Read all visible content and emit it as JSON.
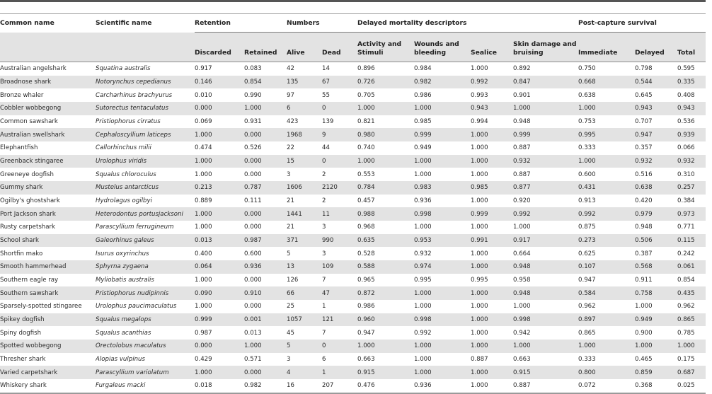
{
  "table": {
    "group_headers": {
      "common_name": "Common name",
      "scientific_name": "Scientific name",
      "retention": "Retention",
      "numbers": "Numbers",
      "delayed_mortality": "Delayed mortality descriptors",
      "post_capture": "Post-capture survival"
    },
    "sub_headers": {
      "discarded": "Discarded",
      "retained": "Retained",
      "alive": "Alive",
      "dead": "Dead",
      "activity": "Activity and Stimuli",
      "wounds": "Wounds and bleeding",
      "sealice": "Sealice",
      "skin": "Skin damage and bruising",
      "immediate": "Immediate",
      "delayed": "Delayed",
      "total": "Total"
    },
    "rows": [
      [
        "Australian angelshark",
        "Squatina australis",
        "0.917",
        "0.083",
        "42",
        "14",
        "0.896",
        "0.984",
        "1.000",
        "0.892",
        "0.750",
        "0.798",
        "0.595"
      ],
      [
        "Broadnose shark",
        "Notorynchus cepedianus",
        "0.146",
        "0.854",
        "135",
        "67",
        "0.726",
        "0.982",
        "0.992",
        "0.847",
        "0.668",
        "0.544",
        "0.335"
      ],
      [
        "Bronze whaler",
        "Carcharhinus brachyurus",
        "0.010",
        "0.990",
        "97",
        "55",
        "0.705",
        "0.986",
        "0.993",
        "0.901",
        "0.638",
        "0.645",
        "0.408"
      ],
      [
        "Cobbler wobbegong",
        "Sutorectus tentaculatus",
        "0.000",
        "1.000",
        "6",
        "0",
        "1.000",
        "1.000",
        "0.943",
        "1.000",
        "1.000",
        "0.943",
        "0.943"
      ],
      [
        "Common sawshark",
        "Pristiophorus cirratus",
        "0.069",
        "0.931",
        "423",
        "139",
        "0.821",
        "0.985",
        "0.994",
        "0.948",
        "0.753",
        "0.707",
        "0.536"
      ],
      [
        "Australian swellshark",
        "Cephaloscyllium laticeps",
        "1.000",
        "0.000",
        "1968",
        "9",
        "0.980",
        "0.999",
        "1.000",
        "0.999",
        "0.995",
        "0.947",
        "0.939"
      ],
      [
        "Elephantfish",
        "Callorhinchus milii",
        "0.474",
        "0.526",
        "22",
        "44",
        "0.740",
        "0.949",
        "1.000",
        "0.887",
        "0.333",
        "0.357",
        "0.066"
      ],
      [
        "Greenback stingaree",
        "Urolophus viridis",
        "1.000",
        "0.000",
        "15",
        "0",
        "1.000",
        "1.000",
        "1.000",
        "0.932",
        "1.000",
        "0.932",
        "0.932"
      ],
      [
        "Greeneye dogfish",
        "Squalus chloroculus",
        "1.000",
        "0.000",
        "3",
        "2",
        "0.553",
        "1.000",
        "1.000",
        "0.887",
        "0.600",
        "0.516",
        "0.310"
      ],
      [
        "Gummy shark",
        "Mustelus antarcticus",
        "0.213",
        "0.787",
        "1606",
        "2120",
        "0.784",
        "0.983",
        "0.985",
        "0.877",
        "0.431",
        "0.638",
        "0.257"
      ],
      [
        "Ogilby's ghostshark",
        "Hydrolagus ogilbyi",
        "0.889",
        "0.111",
        "21",
        "2",
        "0.457",
        "0.936",
        "1.000",
        "0.920",
        "0.913",
        "0.420",
        "0.384"
      ],
      [
        "Port Jackson shark",
        "Heterodontus portusjacksoni",
        "1.000",
        "0.000",
        "1441",
        "11",
        "0.988",
        "0.998",
        "0.999",
        "0.992",
        "0.992",
        "0.979",
        "0.973"
      ],
      [
        "Rusty carpetshark",
        "Parascyllium ferrugineum",
        "1.000",
        "0.000",
        "21",
        "3",
        "0.968",
        "1.000",
        "1.000",
        "1.000",
        "0.875",
        "0.948",
        "0.771"
      ],
      [
        "School shark",
        "Galeorhinus galeus",
        "0.013",
        "0.987",
        "371",
        "990",
        "0.635",
        "0.953",
        "0.991",
        "0.917",
        "0.273",
        "0.506",
        "0.115"
      ],
      [
        "Shortfin mako",
        "Isurus oxyrinchus",
        "0.400",
        "0.600",
        "5",
        "3",
        "0.528",
        "0.932",
        "1.000",
        "0.664",
        "0.625",
        "0.387",
        "0.242"
      ],
      [
        "Smooth hammerhead",
        "Sphyrna zygaena",
        "0.064",
        "0.936",
        "13",
        "109",
        "0.588",
        "0.974",
        "1.000",
        "0.948",
        "0.107",
        "0.568",
        "0.061"
      ],
      [
        "Southern eagle ray",
        "Myliobatis australis",
        "1.000",
        "0.000",
        "126",
        "7",
        "0.965",
        "0.995",
        "0.995",
        "0.958",
        "0.947",
        "0.911",
        "0.854"
      ],
      [
        "Southern sawshark",
        "Pristiophorus nudipinnis",
        "0.090",
        "0.910",
        "66",
        "47",
        "0.872",
        "1.000",
        "1.000",
        "0.948",
        "0.584",
        "0.758",
        "0.435"
      ],
      [
        "Sparsely-spotted stingaree",
        "Urolophus paucimaculatus",
        "1.000",
        "0.000",
        "25",
        "1",
        "0.986",
        "1.000",
        "1.000",
        "1.000",
        "0.962",
        "1.000",
        "0.962"
      ],
      [
        "Spikey dogfish",
        "Squalus megalops",
        "0.999",
        "0.001",
        "1057",
        "121",
        "0.960",
        "0.998",
        "1.000",
        "0.998",
        "0.897",
        "0.949",
        "0.865"
      ],
      [
        "Spiny dogfish",
        "Squalus acanthias",
        "0.987",
        "0.013",
        "45",
        "7",
        "0.947",
        "0.992",
        "1.000",
        "0.942",
        "0.865",
        "0.900",
        "0.785"
      ],
      [
        "Spotted wobbegong",
        "Orectolobus maculatus",
        "0.000",
        "1.000",
        "5",
        "0",
        "1.000",
        "1.000",
        "1.000",
        "1.000",
        "1.000",
        "1.000",
        "1.000"
      ],
      [
        "Thresher shark",
        "Alopias vulpinus",
        "0.429",
        "0.571",
        "3",
        "6",
        "0.663",
        "1.000",
        "0.887",
        "0.663",
        "0.333",
        "0.465",
        "0.175"
      ],
      [
        "Varied carpetshark",
        "Parascyllium variolatum",
        "1.000",
        "0.000",
        "4",
        "1",
        "0.915",
        "1.000",
        "1.000",
        "0.915",
        "0.800",
        "0.859",
        "0.687"
      ],
      [
        "Whiskery shark",
        "Furgaleus macki",
        "0.018",
        "0.982",
        "16",
        "207",
        "0.476",
        "0.936",
        "1.000",
        "0.887",
        "0.072",
        "0.368",
        "0.025"
      ]
    ]
  }
}
